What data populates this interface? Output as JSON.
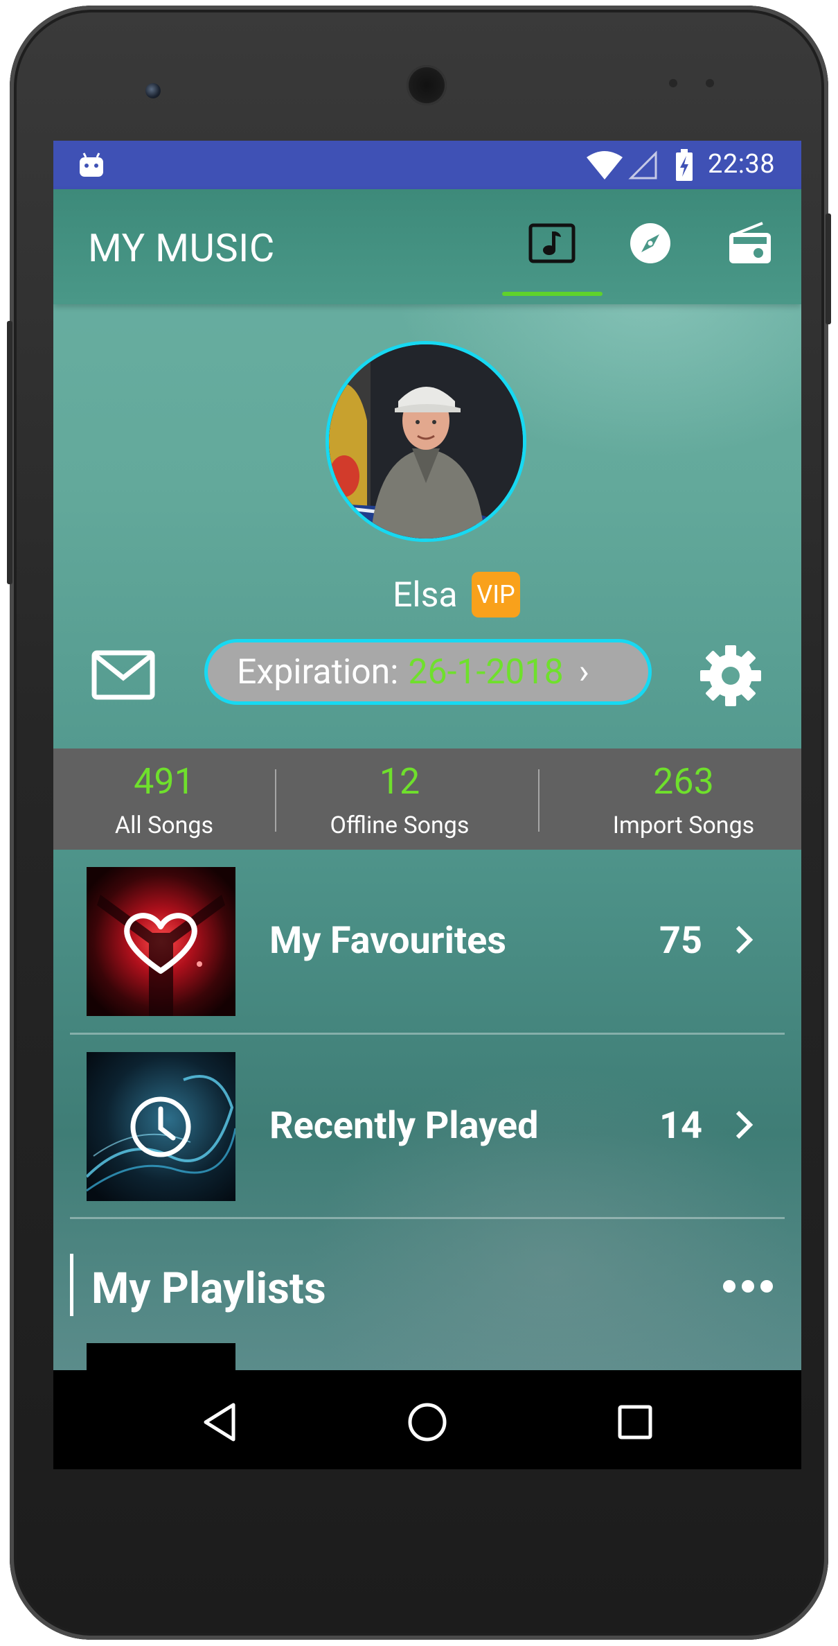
{
  "status_bar": {
    "time": "22:38"
  },
  "toolbar": {
    "title": "MY MUSIC",
    "tabs": [
      {
        "icon": "music-note-icon",
        "selected": true
      },
      {
        "icon": "compass-icon",
        "selected": false
      },
      {
        "icon": "radio-icon",
        "selected": false
      }
    ],
    "indicator_color": "#5fd22b"
  },
  "profile": {
    "name": "Elsa",
    "badge": "VIP",
    "expiration_label": "Expiration:",
    "expiration_date": "26-1-2018",
    "expiration_chevron": "›"
  },
  "stats": [
    {
      "value": "491",
      "label": "All Songs"
    },
    {
      "value": "12",
      "label": "Offline Songs"
    },
    {
      "value": "263",
      "label": "Import Songs"
    }
  ],
  "list": [
    {
      "title": "My Favourites",
      "count": "75",
      "icon": "heart-icon"
    },
    {
      "title": "Recently Played",
      "count": "14",
      "icon": "clock-icon"
    }
  ],
  "playlists": {
    "title": "My Playlists"
  },
  "colors": {
    "status_bar": "#3f51b5",
    "accent_green": "#6fe02c",
    "accent_cyan": "#17d9f2",
    "vip_orange": "#f9a11b",
    "stats_bg": "#616161"
  }
}
